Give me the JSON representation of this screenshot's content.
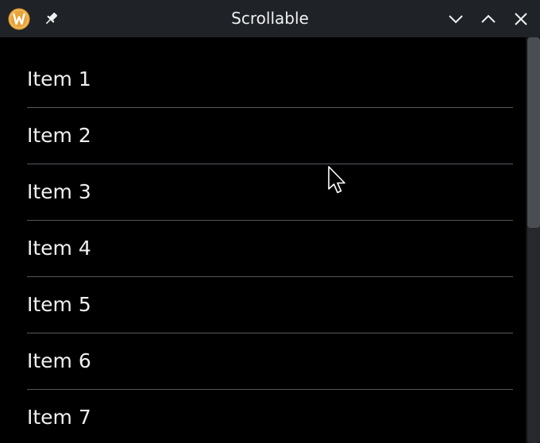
{
  "window": {
    "title": "Scrollable",
    "icons": {
      "app": "w-logo-icon",
      "pin": "pin-icon",
      "minimize": "chevron-down-icon",
      "maximize": "chevron-up-icon",
      "close": "close-icon"
    }
  },
  "list": {
    "items": [
      {
        "label": "Item 1"
      },
      {
        "label": "Item 2"
      },
      {
        "label": "Item 3"
      },
      {
        "label": "Item 4"
      },
      {
        "label": "Item 5"
      },
      {
        "label": "Item 6"
      },
      {
        "label": "Item 7"
      }
    ]
  },
  "scrollbar": {
    "thumb_fraction": 0.47,
    "scroll_position": 0
  },
  "colors": {
    "titlebar_bg": "#1f2226",
    "content_bg": "#000000",
    "text": "#eff0f1",
    "divider": "#55585d",
    "app_icon": "#e8a33a"
  }
}
